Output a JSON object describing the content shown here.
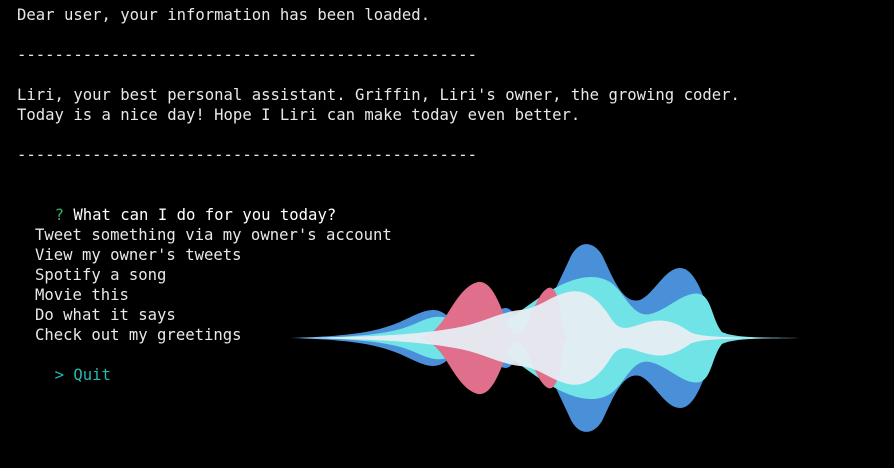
{
  "terminal": {
    "welcome": "Dear user, your information has been loaded.",
    "divider": "-------------------------------------------------",
    "intro_line1": "Liri, your best personal assistant. Griffin, Liri's owner, the growing coder.",
    "intro_line2": "Today is a nice day! Hope I Liri can make today even better.",
    "prompt": {
      "marker": "?",
      "question": "What can I do for you today?"
    },
    "menu": {
      "items": [
        "Tweet something via my owner's account",
        "View my owner's tweets",
        "Spotify a song",
        "Movie this",
        "Do what it says",
        "Check out my greetings"
      ],
      "selected_marker": ">",
      "selected": "Quit"
    }
  },
  "colors": {
    "background": "#000000",
    "text": "#e8e8e8",
    "prompt_marker": "#2fb36b",
    "selected_option": "#27b7b2",
    "wave_blue": "#4a90d9",
    "wave_cyan": "#6fe3e6",
    "wave_pink": "#e06f8b",
    "wave_white": "#e6edf3"
  },
  "graphic": {
    "icon": "siri-waveform-icon"
  }
}
